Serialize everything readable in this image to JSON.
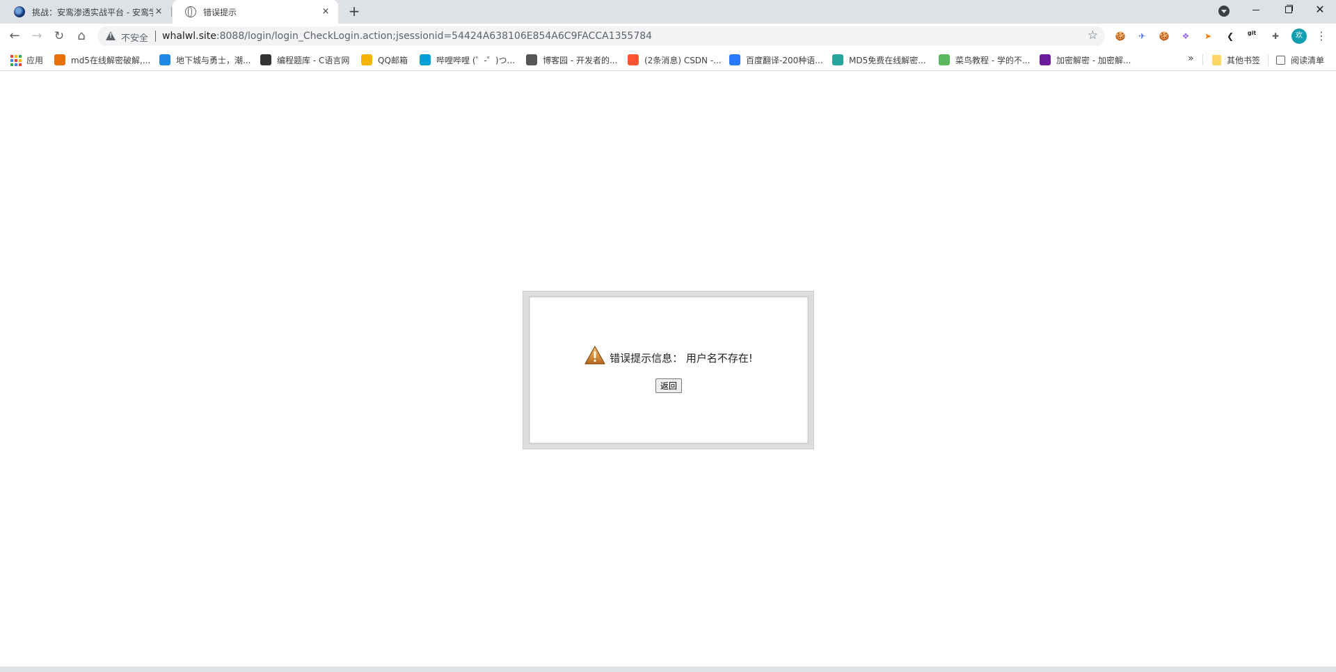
{
  "tabs": [
    {
      "title": "挑战：安鸾渗透实战平台 - 安鸾学",
      "close": "×"
    },
    {
      "title": "错误提示",
      "close": "×"
    }
  ],
  "new_tab": "+",
  "window": {
    "close": "✕"
  },
  "toolbar": {
    "back": "←",
    "forward": "→",
    "reload": "↻",
    "home": "⌂",
    "security_label": "不安全",
    "url_host": "whalwl.site",
    "url_rest": ":8088/login/login_CheckLogin.action;jsessionid=54424A638106E854A6C9FACCA1355784",
    "star": "☆",
    "profile_initial": "欢",
    "menu": "⋮"
  },
  "extensions": [
    {
      "name": "cookie-ext-icon",
      "glyph": "🍪",
      "color": "#f4b400"
    },
    {
      "name": "bird-ext-icon",
      "glyph": "✈",
      "color": "#4a6cf7"
    },
    {
      "name": "cookie-editor-icon",
      "glyph": "🍪",
      "color": "#8d5524"
    },
    {
      "name": "feather-ext-icon",
      "glyph": "❖",
      "color": "#a06cf0"
    },
    {
      "name": "fish-ext-icon",
      "glyph": "➤",
      "color": "#f57c00"
    },
    {
      "name": "back-ext-icon",
      "glyph": "❮",
      "color": "#202124"
    },
    {
      "name": "gitzip-ext-icon",
      "glyph": "git",
      "color": "#202124"
    },
    {
      "name": "puzzle-icon",
      "glyph": "✚",
      "color": "#5f6368"
    }
  ],
  "bookmarks": [
    {
      "label": "应用",
      "color": "#e53935"
    },
    {
      "label": "md5在线解密破解,...",
      "color": "#e8710a"
    },
    {
      "label": "地下城与勇士，潮...",
      "color": "#1e88e5"
    },
    {
      "label": "编程题库 - C语言网",
      "color": "#333333"
    },
    {
      "label": "QQ邮箱",
      "color": "#f4b400"
    },
    {
      "label": "哔哩哔哩 (゜-゜)つ...",
      "color": "#00a1d6"
    },
    {
      "label": "博客园 - 开发者的...",
      "color": "#555555"
    },
    {
      "label": "(2条消息) CSDN -...",
      "color": "#fc5531"
    },
    {
      "label": "百度翻译-200种语...",
      "color": "#2979ff"
    },
    {
      "label": "MD5免费在线解密...",
      "color": "#26a69a"
    },
    {
      "label": "菜鸟教程 - 学的不...",
      "color": "#5cb85c"
    },
    {
      "label": "加密解密 - 加密解...",
      "color": "#6a1b9a"
    }
  ],
  "bookmarks_overflow": "»",
  "other_bookmarks": "其他书签",
  "reading_list": "阅读清单",
  "error_box": {
    "message": "错误提示信息：  用户名不存在!",
    "button": "返回"
  }
}
